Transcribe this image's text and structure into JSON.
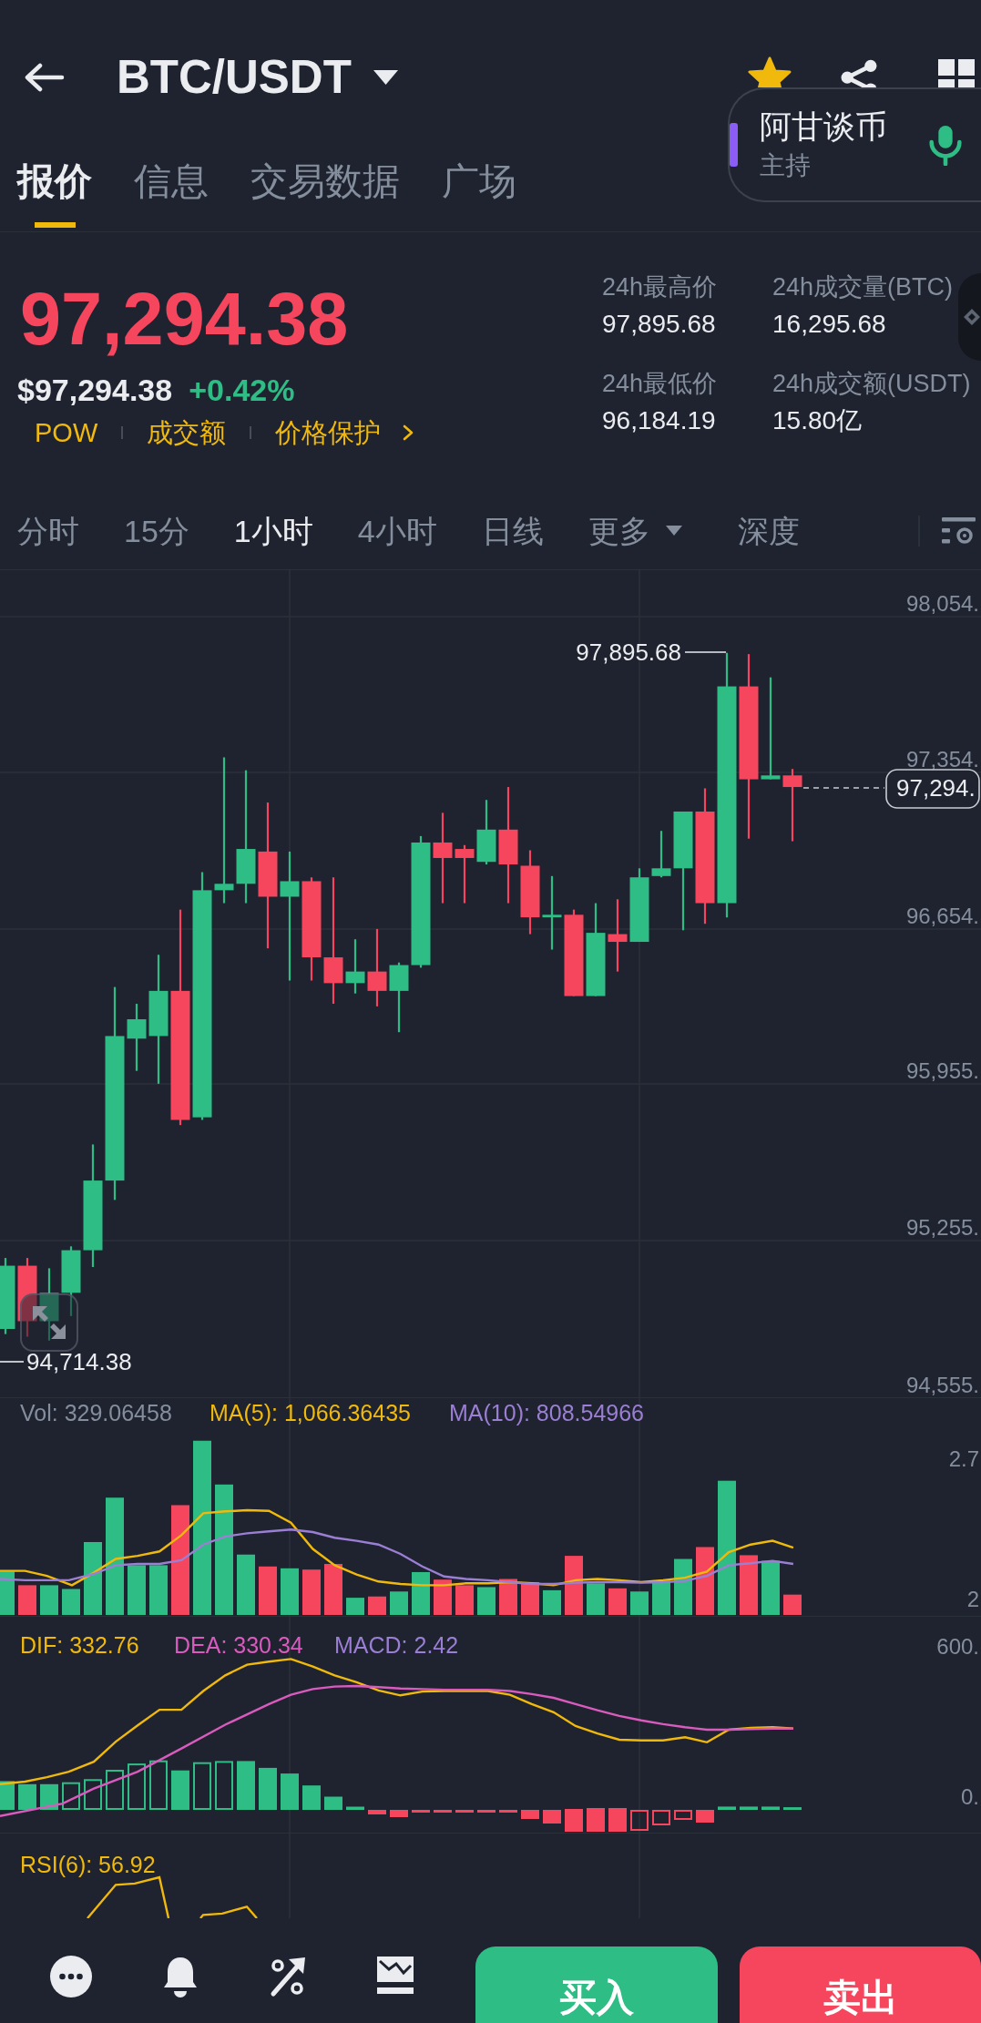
{
  "header": {
    "pair": "BTC/USDT",
    "favorite": true
  },
  "live_host": {
    "name": "阿甘谈币",
    "role": "主持"
  },
  "tabs": [
    {
      "label": "报价",
      "selected": true
    },
    {
      "label": "信息",
      "selected": false
    },
    {
      "label": "交易数据",
      "selected": false
    },
    {
      "label": "广场",
      "selected": false
    }
  ],
  "price": {
    "last": "97,294.38",
    "usd": "$97,294.38",
    "change": "+0.42%",
    "tags": [
      {
        "label": "POW",
        "kind": "tag"
      },
      {
        "label": "成交额",
        "kind": "tag"
      },
      {
        "label": "价格保护",
        "kind": "link"
      }
    ]
  },
  "stats": [
    {
      "label": "24h最高价",
      "value": "97,895.68"
    },
    {
      "label": "24h成交量(BTC)",
      "value": "16,295.68"
    },
    {
      "label": "24h最低价",
      "value": "96,184.19"
    },
    {
      "label": "24h成交额(USDT)",
      "value": "15.80亿"
    }
  ],
  "intervals": [
    {
      "label": "分时",
      "selected": false,
      "kind": "interval"
    },
    {
      "label": "15分",
      "selected": false,
      "kind": "interval"
    },
    {
      "label": "1小时",
      "selected": true,
      "kind": "interval"
    },
    {
      "label": "4小时",
      "selected": false,
      "kind": "interval"
    },
    {
      "label": "日线",
      "selected": false,
      "kind": "interval"
    },
    {
      "label": "更多",
      "selected": false,
      "kind": "dropdown"
    },
    {
      "label": "深度",
      "selected": false,
      "kind": "interval"
    }
  ],
  "price_chart": {
    "axis_labels": [
      "98,054.",
      "97,354.",
      "96,654.",
      "95,955.",
      "95,255.",
      "94,555."
    ],
    "high_label": "97,895.68",
    "low_label": "94,714.38",
    "last_price_tag": "97,294."
  },
  "volume_panel": {
    "legend": [
      {
        "text": "Vol: 329.06458",
        "color": "#848e9c"
      },
      {
        "text": "MA(5): 1,066.36435",
        "color": "#f0b90b"
      },
      {
        "text": "MA(10): 808.54966",
        "color": "#9b7fd4"
      }
    ],
    "axis_labels": [
      "2.7",
      "2"
    ]
  },
  "macd_panel": {
    "legend": [
      {
        "text": "DIF: 332.76",
        "color": "#f0b90b"
      },
      {
        "text": "DEA: 330.34",
        "color": "#d95bbd"
      },
      {
        "text": "MACD: 2.42",
        "color": "#9b7fd4"
      }
    ],
    "axis_labels": [
      "600.",
      "0."
    ]
  },
  "rsi_panel": {
    "legend": [
      {
        "text": "RSI(6): 56.92",
        "color": "#f0b90b"
      }
    ]
  },
  "trade_bar": {
    "buy": "买入",
    "sell": "卖出"
  }
}
